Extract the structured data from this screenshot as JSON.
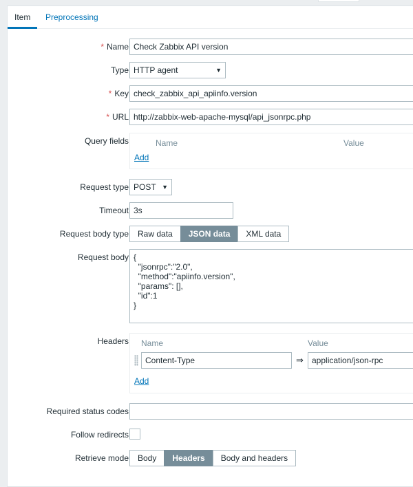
{
  "tabs": [
    {
      "label": "Item",
      "active": true
    },
    {
      "label": "Preprocessing",
      "active": false
    }
  ],
  "form": {
    "name": {
      "label": "Name",
      "value": "Check Zabbix API version"
    },
    "type": {
      "label": "Type",
      "value": "HTTP agent"
    },
    "key": {
      "label": "Key",
      "value": "check_zabbix_api_apiinfo.version"
    },
    "url": {
      "label": "URL",
      "value": "http://zabbix-web-apache-mysql/api_jsonrpc.php"
    },
    "query_fields": {
      "label": "Query fields",
      "col_name": "Name",
      "col_value": "Value",
      "add_label": "Add"
    },
    "request_type": {
      "label": "Request type",
      "value": "POST"
    },
    "timeout": {
      "label": "Timeout",
      "value": "3s"
    },
    "request_body_type": {
      "label": "Request body type",
      "options": [
        "Raw data",
        "JSON data",
        "XML data"
      ],
      "selected": "JSON data"
    },
    "request_body": {
      "label": "Request body",
      "value": "{\n  \"jsonrpc\":\"2.0\",\n  \"method\":\"apiinfo.version\",\n  \"params\": [],\n  \"id\":1\n}"
    },
    "headers": {
      "label": "Headers",
      "col_name": "Name",
      "col_value": "Value",
      "rows": [
        {
          "name": "Content-Type",
          "value": "application/json-rpc"
        }
      ],
      "arrow": "⇒",
      "add_label": "Add"
    },
    "required_status_codes": {
      "label": "Required status codes",
      "value": ""
    },
    "follow_redirects": {
      "label": "Follow redirects",
      "checked": false
    },
    "retrieve_mode": {
      "label": "Retrieve mode",
      "options": [
        "Body",
        "Headers",
        "Body and headers"
      ],
      "selected": "Headers"
    }
  },
  "colors": {
    "accent": "#0275b8",
    "required": "#d64e4e",
    "selected_segment": "#768d99"
  },
  "icons": {
    "dropdown": "triangle-down-icon",
    "drag": "drag-handle-icon",
    "arrow": "double-arrow-right-icon"
  }
}
